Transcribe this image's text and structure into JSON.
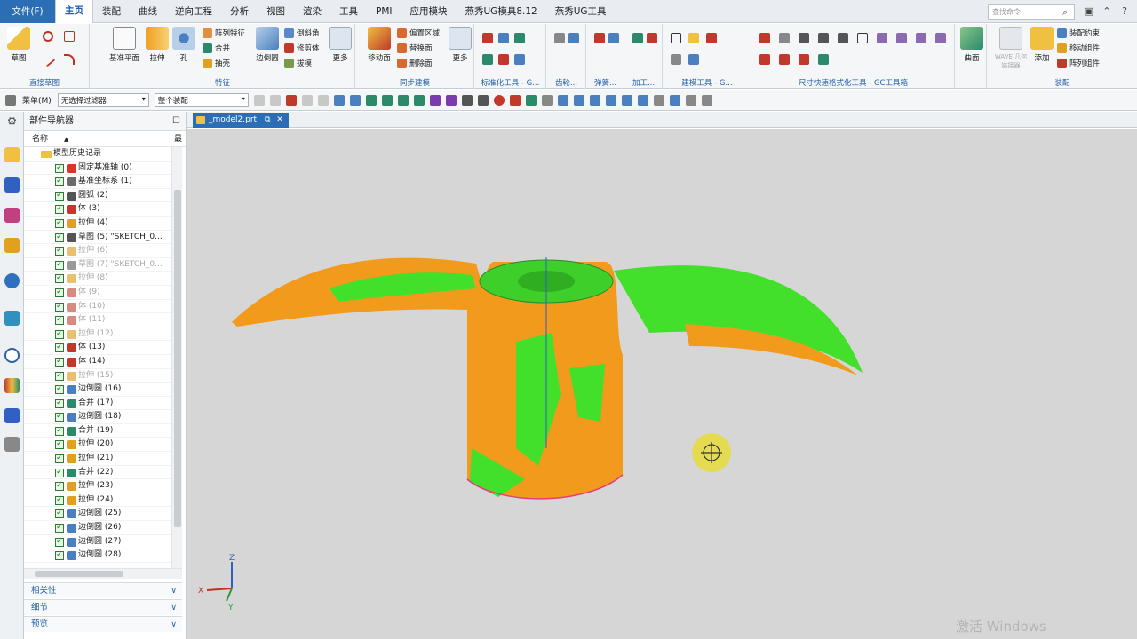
{
  "menubar": {
    "file": "文件(F)",
    "tabs": [
      "主页",
      "装配",
      "曲线",
      "逆向工程",
      "分析",
      "视图",
      "渲染",
      "工具",
      "PMI",
      "应用模块",
      "燕秀UG模具8.12",
      "燕秀UG工具"
    ],
    "active_tab": "主页",
    "search_placeholder": "查找命令"
  },
  "ribbon": {
    "sketch": {
      "label": "草图",
      "group": "直接草图"
    },
    "feature": {
      "datum_plane": "基准平面",
      "extrude": "拉伸",
      "hole": "孔",
      "pattern": "阵列特征",
      "unite": "合并",
      "shell": "抽壳",
      "edge_blend": "边倒圆",
      "chamfer": "倒斜角",
      "trim_body": "修剪体",
      "draft": "拔模",
      "more": "更多",
      "group": "特征"
    },
    "sync": {
      "move_face": "移动面",
      "offset_region": "偏置区域",
      "replace_face": "替换面",
      "delete_face": "删除面",
      "more": "更多",
      "group": "同步建模"
    },
    "groups": [
      "标准化工具 - G...",
      "齿轮...",
      "弹簧...",
      "加工...",
      "建模工具 - G...",
      "尺寸快速格式化工具 - GC工具箱"
    ],
    "surface": {
      "label": "曲面"
    },
    "assembly": {
      "wave": "WAVE 几何链接器",
      "add": "添加",
      "constraint": "装配约束",
      "move_comp": "移动组件",
      "pattern_comp": "阵列组件",
      "group": "装配"
    }
  },
  "toolbar": {
    "menu": "菜单(M)",
    "filter": "无选择过滤器",
    "scope": "整个装配"
  },
  "navigator": {
    "title": "部件导航器",
    "col_name": "名称",
    "col_last": "最",
    "root": "模型历史记录",
    "items": [
      {
        "label": "固定基准轴 (0)",
        "dim": false,
        "color": "#d23a2a"
      },
      {
        "label": "基准坐标系 (1)",
        "dim": false,
        "color": "#6c6c6c"
      },
      {
        "label": "圆弧 (2)",
        "dim": false,
        "color": "#555555"
      },
      {
        "label": "体 (3)",
        "dim": false,
        "color": "#c0392b"
      },
      {
        "label": "拉伸 (4)",
        "dim": false,
        "color": "#e0a020"
      },
      {
        "label": "草图 (5) \"SKETCH_0...",
        "dim": false,
        "color": "#555555"
      },
      {
        "label": "拉伸 (6)",
        "dim": true,
        "color": "#e8c070"
      },
      {
        "label": "草图 (7) \"SKETCH_0...",
        "dim": true,
        "color": "#999999"
      },
      {
        "label": "拉伸 (8)",
        "dim": true,
        "color": "#e8c070"
      },
      {
        "label": "体 (9)",
        "dim": true,
        "color": "#d98a80"
      },
      {
        "label": "体 (10)",
        "dim": true,
        "color": "#d98a80"
      },
      {
        "label": "体 (11)",
        "dim": true,
        "color": "#d98a80"
      },
      {
        "label": "拉伸 (12)",
        "dim": true,
        "color": "#e8c070"
      },
      {
        "label": "体 (13)",
        "dim": false,
        "color": "#c0392b"
      },
      {
        "label": "体 (14)",
        "dim": false,
        "color": "#c0392b"
      },
      {
        "label": "拉伸 (15)",
        "dim": true,
        "color": "#e8c070"
      },
      {
        "label": "边倒圆 (16)",
        "dim": false,
        "color": "#4a7fc0"
      },
      {
        "label": "合并 (17)",
        "dim": false,
        "color": "#2a8a6a"
      },
      {
        "label": "边倒圆 (18)",
        "dim": false,
        "color": "#4a7fc0"
      },
      {
        "label": "合并 (19)",
        "dim": false,
        "color": "#2a8a6a"
      },
      {
        "label": "拉伸 (20)",
        "dim": false,
        "color": "#e0a020"
      },
      {
        "label": "拉伸 (21)",
        "dim": false,
        "color": "#e0a020"
      },
      {
        "label": "合并 (22)",
        "dim": false,
        "color": "#2a8a6a"
      },
      {
        "label": "拉伸 (23)",
        "dim": false,
        "color": "#e0a020"
      },
      {
        "label": "拉伸 (24)",
        "dim": false,
        "color": "#e0a020"
      },
      {
        "label": "边倒圆 (25)",
        "dim": false,
        "color": "#4a7fc0"
      },
      {
        "label": "边倒圆 (26)",
        "dim": false,
        "color": "#4a7fc0"
      },
      {
        "label": "边倒圆 (27)",
        "dim": false,
        "color": "#4a7fc0"
      },
      {
        "label": "边倒圆 (28)",
        "dim": false,
        "color": "#4a7fc0"
      }
    ],
    "panels": [
      "相关性",
      "细节",
      "预览"
    ]
  },
  "document": {
    "tab": "_model2.prt"
  },
  "viewport": {
    "triad_labels": [
      "Z",
      "X",
      "Y"
    ],
    "watermark": "激活 Windows"
  }
}
